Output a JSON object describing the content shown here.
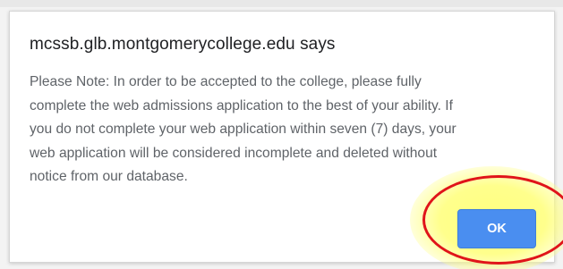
{
  "dialog": {
    "title": "mcssb.glb.montgomerycollege.edu says",
    "message_lines": [
      "Please Note: In order to be accepted to the college, please fully",
      "complete the web admissions application to the best of your ability. If",
      "you do not complete your web application within seven (7) days, your",
      "web application will be considered incomplete and deleted without",
      "notice from our database."
    ],
    "ok_label": "OK"
  },
  "colors": {
    "button": "#4a8ef0",
    "highlight_ring": "#e0141a",
    "highlight_glow": "#ffff78"
  }
}
